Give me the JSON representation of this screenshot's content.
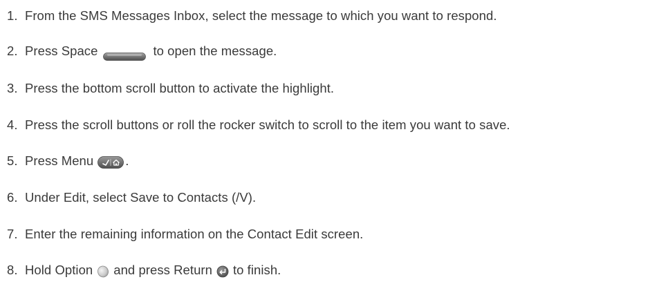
{
  "steps": [
    {
      "num": "1.",
      "text": "From the SMS Messages Inbox, select the message to which you want to respond."
    },
    {
      "num": "2.",
      "pre": "Press Space",
      "post": "to open the message."
    },
    {
      "num": "3.",
      "text": "Press the bottom scroll button to activate the highlight."
    },
    {
      "num": "4.",
      "text": "Press the scroll buttons or roll the rocker switch to scroll to the item you want to save."
    },
    {
      "num": "5.",
      "pre": "Press Menu",
      "post": "."
    },
    {
      "num": "6.",
      "text": "Under Edit, select Save to Contacts (/V)."
    },
    {
      "num": "7.",
      "text": "Enter the remaining information on the Contact Edit screen."
    },
    {
      "num": "8.",
      "pre": "Hold Option",
      "mid": "and press Return",
      "post": "to finish."
    }
  ],
  "icons": {
    "space": "space-key-icon",
    "menu": "menu-key-icon",
    "option": "option-key-icon",
    "return": "return-key-icon"
  }
}
